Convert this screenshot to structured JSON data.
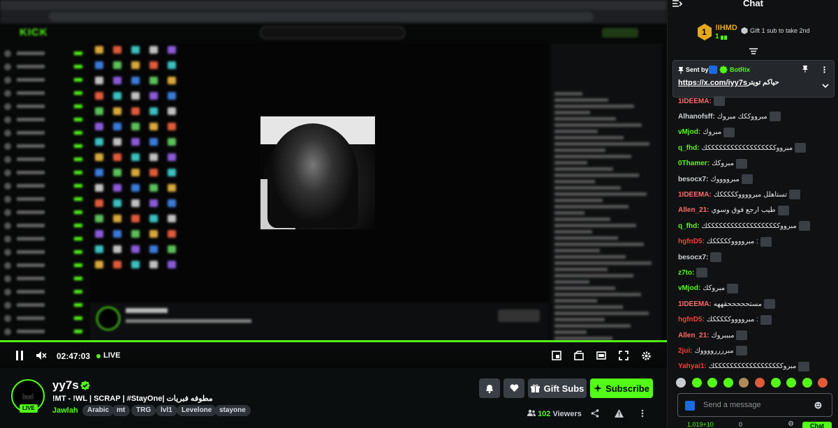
{
  "player": {
    "time": "02:47:03",
    "live_label": "LIVE"
  },
  "info": {
    "channel_name": "yy7s",
    "live_badge": "LIVE",
    "stream_title": "!MT - !WL | SCRAP | #StayOne| مطوفه فبريات",
    "category": "Jawlah",
    "tags": [
      "Arabic",
      "mt",
      "TRG",
      "lvl1",
      "Levelone",
      "stayone"
    ],
    "gift_subs_label": "Gift Subs",
    "subscribe_label": "Subscribe",
    "viewers_count": "102",
    "viewers_label": "Viewers"
  },
  "chat": {
    "title": "Chat",
    "top_gifter": {
      "rank": "1",
      "name": "!IHMD",
      "count": "1",
      "gift_label": "Gift 1 sub to take 2nd"
    },
    "pinned": {
      "sent_by_label": "Sent by",
      "sender": "BotRix",
      "link": "https://x.com/iyy7s",
      "message": "حياكم تويتر"
    },
    "messages": [
      {
        "user": "1IDEEMA",
        "text": "",
        "color": "#ff6b6b"
      },
      {
        "user": "Alhanofsff",
        "text": "مبرووككك مبروك",
        "color": "#cfd3d7"
      },
      {
        "user": "vMjod",
        "text": "مبروك",
        "color": "#53fc18"
      },
      {
        "user": "q_fhd",
        "text": "مبرووككككككككككككككككككك",
        "color": "#53fc18"
      },
      {
        "user": "0Thamer",
        "text": "مبروكك",
        "color": "#53fc18"
      },
      {
        "user": "besocx7",
        "text": "مبرووووك",
        "color": "#cfd3d7"
      },
      {
        "user": "1IDEEMA",
        "text": "تستاهلل مبرووووكككككك",
        "color": "#ff6b6b"
      },
      {
        "user": "Allen_21",
        "text": "طيب ارجع فوق وسوي",
        "color": "#ff6b6b"
      },
      {
        "user": "q_fhd",
        "text": "مبرووكككككككككككككككككككك",
        "color": "#53fc18"
      },
      {
        "user": "hgfnD5",
        "text": ": مبرووووكككككك",
        "color": "#ff3b3b"
      },
      {
        "user": "besocx7",
        "text": "",
        "color": "#cfd3d7"
      },
      {
        "user": "z7to",
        "text": "",
        "color": "#53fc18"
      },
      {
        "user": "vMjod",
        "text": "مبروكك",
        "color": "#53fc18"
      },
      {
        "user": "1IDEEMA",
        "text": "مستحححححقههه",
        "color": "#ff6b6b"
      },
      {
        "user": "hgfnD5",
        "text": ": مبرووووكككككك",
        "color": "#ff3b3b"
      },
      {
        "user": "Allen_21",
        "text": "مبببروك",
        "color": "#ff6b6b"
      },
      {
        "user": "2jui",
        "text": "مبررررووووك",
        "color": "#ff3b3b"
      },
      {
        "user": "Yahyai1",
        "text": "مبروككككككككككككككككككك",
        "color": "#ff3b3b"
      }
    ],
    "input_placeholder": "Send a message",
    "send_label": "Chat",
    "footer_count": "1,019+10",
    "footer_extra": "0"
  },
  "colors": {
    "accent": "#53fc18",
    "background": "#0b0e0f",
    "button": "#3a3f45"
  }
}
